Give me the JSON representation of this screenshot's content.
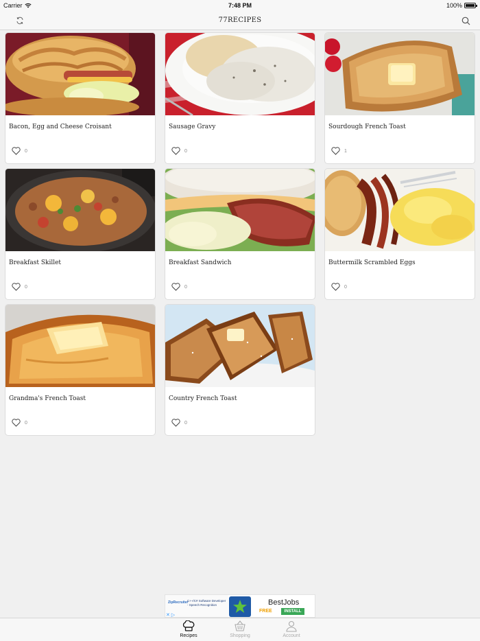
{
  "status_bar": {
    "carrier": "Carrier",
    "time": "7:48 PM",
    "battery": "100%"
  },
  "nav": {
    "title": "77RECIPES",
    "left_icon": "refresh-icon",
    "right_icon": "search-icon"
  },
  "recipes": [
    {
      "title": "Bacon, Egg and Cheese Croisant",
      "likes": "0"
    },
    {
      "title": "Sausage Gravy",
      "likes": "0"
    },
    {
      "title": "Sourdough French Toast",
      "likes": "1"
    },
    {
      "title": "Breakfast Skillet",
      "likes": "0"
    },
    {
      "title": "Breakfast Sandwich",
      "likes": "0"
    },
    {
      "title": "Buttermilk Scrambled Eggs",
      "likes": "0"
    },
    {
      "title": "Grandma's French Toast",
      "likes": "0"
    },
    {
      "title": "Country French Toast",
      "likes": "0"
    }
  ],
  "ad": {
    "logo": "ZipRecruiter",
    "text": "C++/C# Software Developer - Speech Recognition",
    "name": "BestJobs",
    "price": "FREE",
    "cta": "INSTALL"
  },
  "tabs": [
    {
      "label": "Recipes",
      "icon": "chef-hat-icon",
      "active": true
    },
    {
      "label": "Shopping",
      "icon": "basket-icon",
      "active": false
    },
    {
      "label": "Account",
      "icon": "person-icon",
      "active": false
    }
  ],
  "colors": {
    "background": "#f0f0f0",
    "card": "#ffffff",
    "bar": "#f7f7f7",
    "active_tab": "#111111",
    "inactive_tab": "#aaaaaa"
  }
}
